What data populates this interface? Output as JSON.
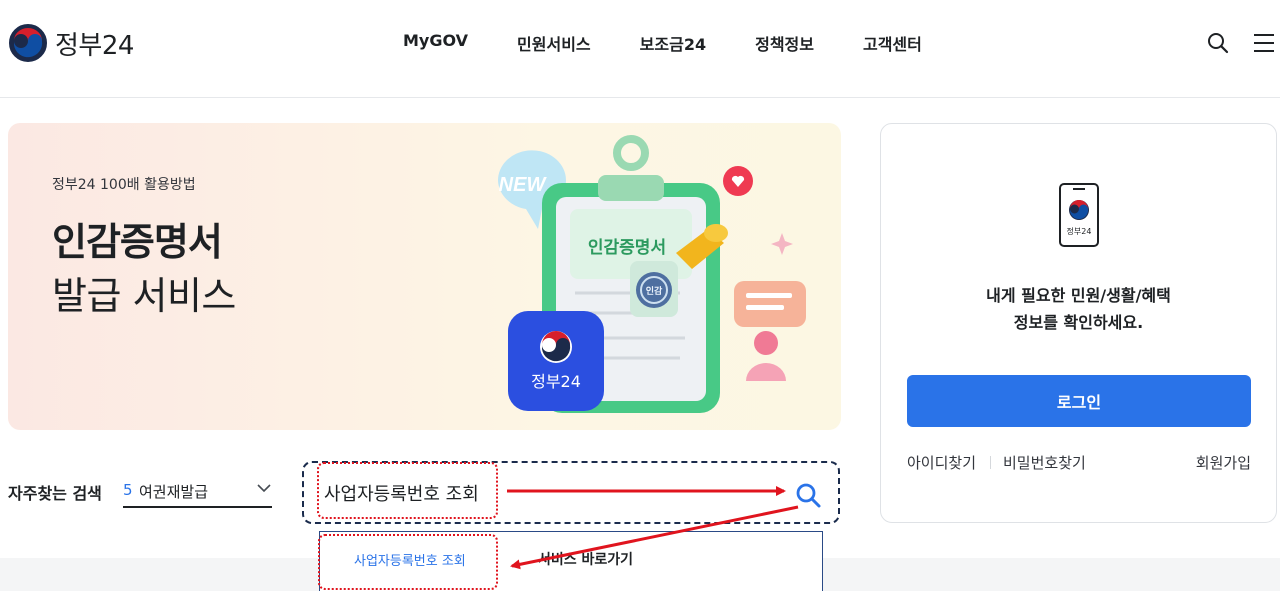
{
  "header": {
    "logo_text": "정부24",
    "nav": [
      "MyGOV",
      "민원서비스",
      "보조금24",
      "정책정보",
      "고객센터"
    ]
  },
  "banner": {
    "subtitle": "정부24 100배 활용방법",
    "title_bold": "인감증명서",
    "title_regular": "발급 서비스",
    "art": {
      "new_bubble": "NEW",
      "clipboard_title": "인감증명서",
      "stamp_text": "인감",
      "app_icon_label": "정부24"
    }
  },
  "login": {
    "device_label": "정부24",
    "message_line1": "내게 필요한 민원/생활/혜택",
    "message_line2": "정보를 확인하세요.",
    "login_button": "로그인",
    "find_id": "아이디찾기",
    "find_password": "비밀번호찾기",
    "signup": "회원가입",
    "accent_color": "#2a73e8"
  },
  "search": {
    "frequent_label": "자주찾는 검색",
    "frequent_rank": "5",
    "frequent_value": "여권재발급",
    "query": "사업자등록번호 조회",
    "suggestion": "사업자등록번호 조회",
    "shortcut_label": "서비스 바로가기"
  },
  "annotation_color": "#e0141e"
}
